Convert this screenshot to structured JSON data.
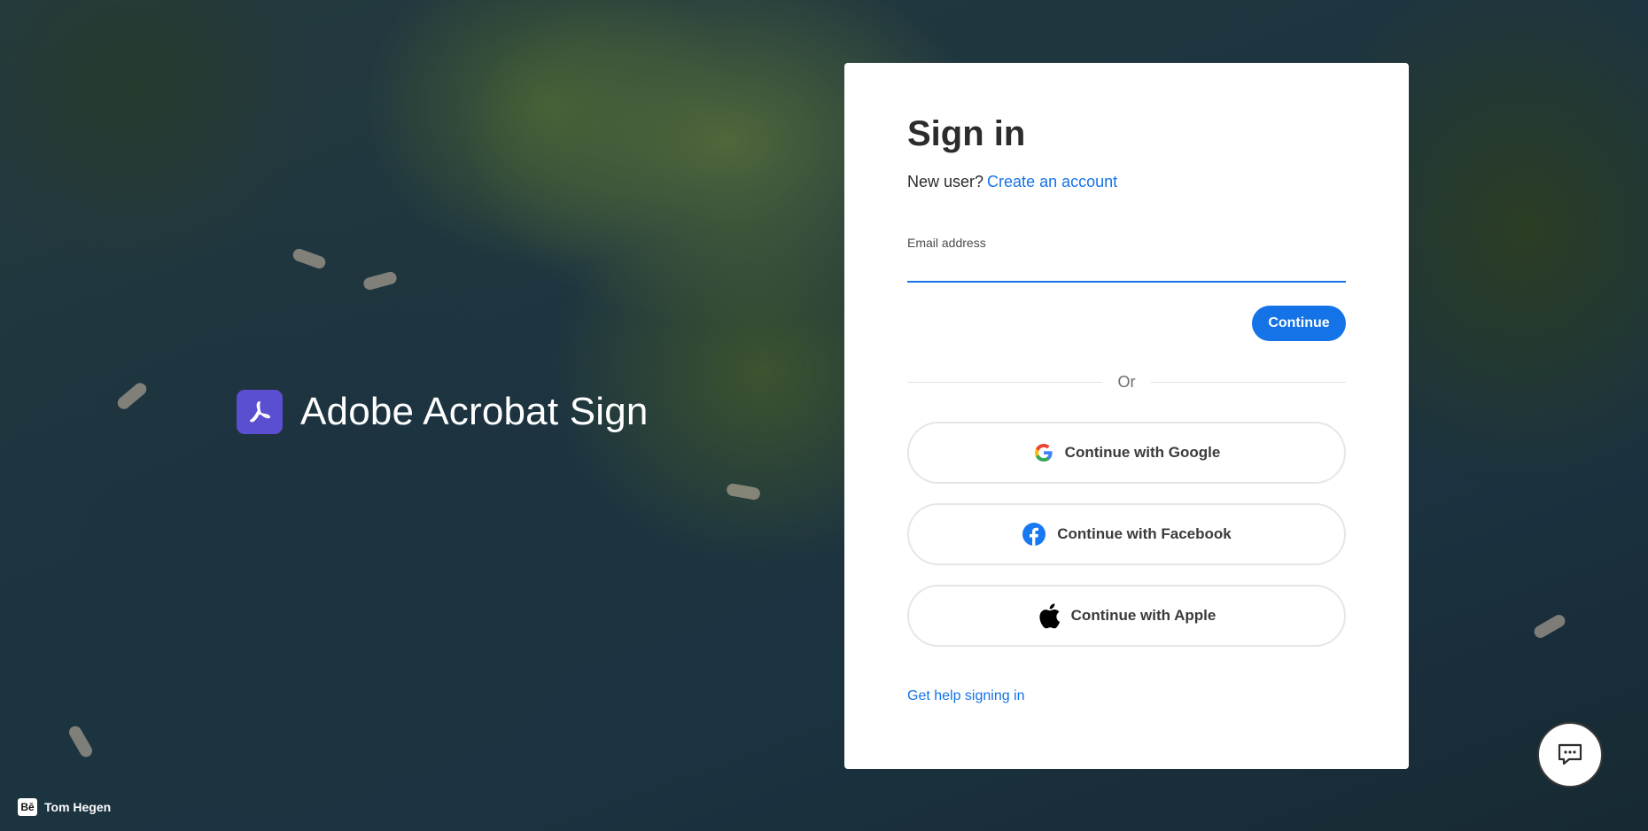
{
  "brand": {
    "name": "Adobe Acrobat Sign",
    "logo_color": "#5a4fd1"
  },
  "credit": {
    "badge": "Bē",
    "name": "Tom Hegen"
  },
  "signin": {
    "title": "Sign in",
    "new_user_text": "New user?",
    "create_account_link": "Create an account",
    "email_label": "Email address",
    "email_value": "",
    "continue_label": "Continue",
    "or_text": "Or",
    "google_label": "Continue with Google",
    "facebook_label": "Continue with Facebook",
    "apple_label": "Continue with Apple",
    "help_link": "Get help signing in"
  },
  "colors": {
    "accent": "#1473e6",
    "facebook": "#1877f2"
  },
  "icons": {
    "google": "google-icon",
    "facebook": "facebook-icon",
    "apple": "apple-icon",
    "chat": "chat-icon",
    "acrobat": "acrobat-logo-icon"
  }
}
